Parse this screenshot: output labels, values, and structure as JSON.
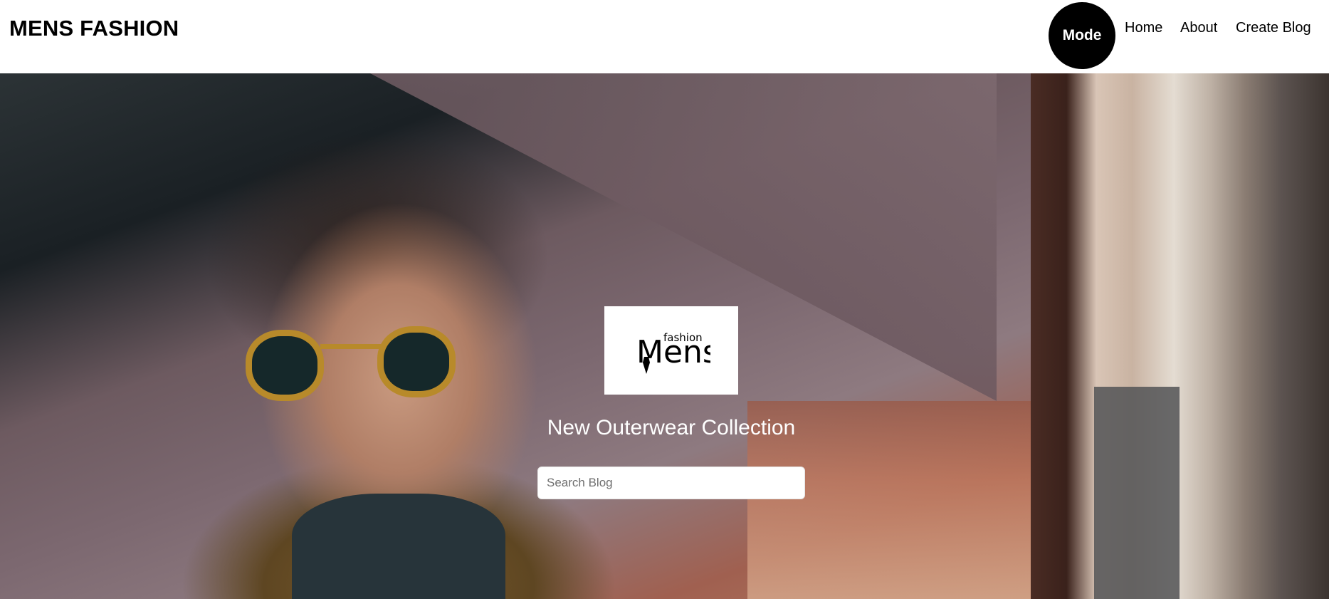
{
  "navbar": {
    "brand": "MENS FASHION",
    "mode_label": "Mode",
    "links": [
      {
        "label": "Home"
      },
      {
        "label": "About"
      },
      {
        "label": "Create Blog"
      }
    ]
  },
  "hero": {
    "logo": {
      "big_text": "Mens",
      "small_text": "fashion",
      "icon": "necktie-icon"
    },
    "headline": "New Outerwear Collection",
    "search": {
      "placeholder": "Search Blog",
      "value": ""
    }
  },
  "colors": {
    "navbar_bg": "#ffffff",
    "mode_button_bg": "#000000",
    "mode_button_text": "#ffffff",
    "headline_text": "#ffffff"
  }
}
